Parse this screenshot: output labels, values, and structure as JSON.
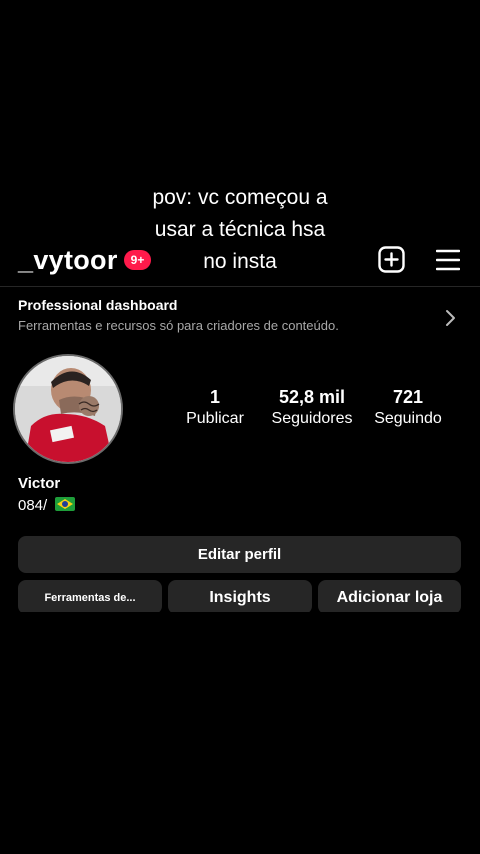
{
  "overlay_caption": [
    "pov: vc começou a",
    "usar a técnica hsa",
    "no insta"
  ],
  "header": {
    "username": "_vytoor",
    "notification_badge": "9+",
    "add_icon": "plus-square-icon",
    "menu_icon": "hamburger-menu-icon"
  },
  "dashboard": {
    "title": "Professional dashboard",
    "subtitle": "Ferramentas e recursos só para criadores de conteúdo.",
    "icon": "chevron-right-icon"
  },
  "profile": {
    "stats": [
      {
        "value": "1",
        "label": "Publicar"
      },
      {
        "value": "52,8 mil",
        "label": "Seguidores"
      },
      {
        "value": "721",
        "label": "Seguindo"
      }
    ],
    "name": "Victor",
    "bio": "084/"
  },
  "buttons": {
    "edit_profile": "Editar perfil",
    "tools": "Ferramentas de...",
    "insights": "Insights",
    "add_shop": "Adicionar loja"
  },
  "colors": {
    "background": "#000000",
    "button_bg": "#262626",
    "badge": "#ff1a4b",
    "secondary_text": "#a8a8a8"
  }
}
